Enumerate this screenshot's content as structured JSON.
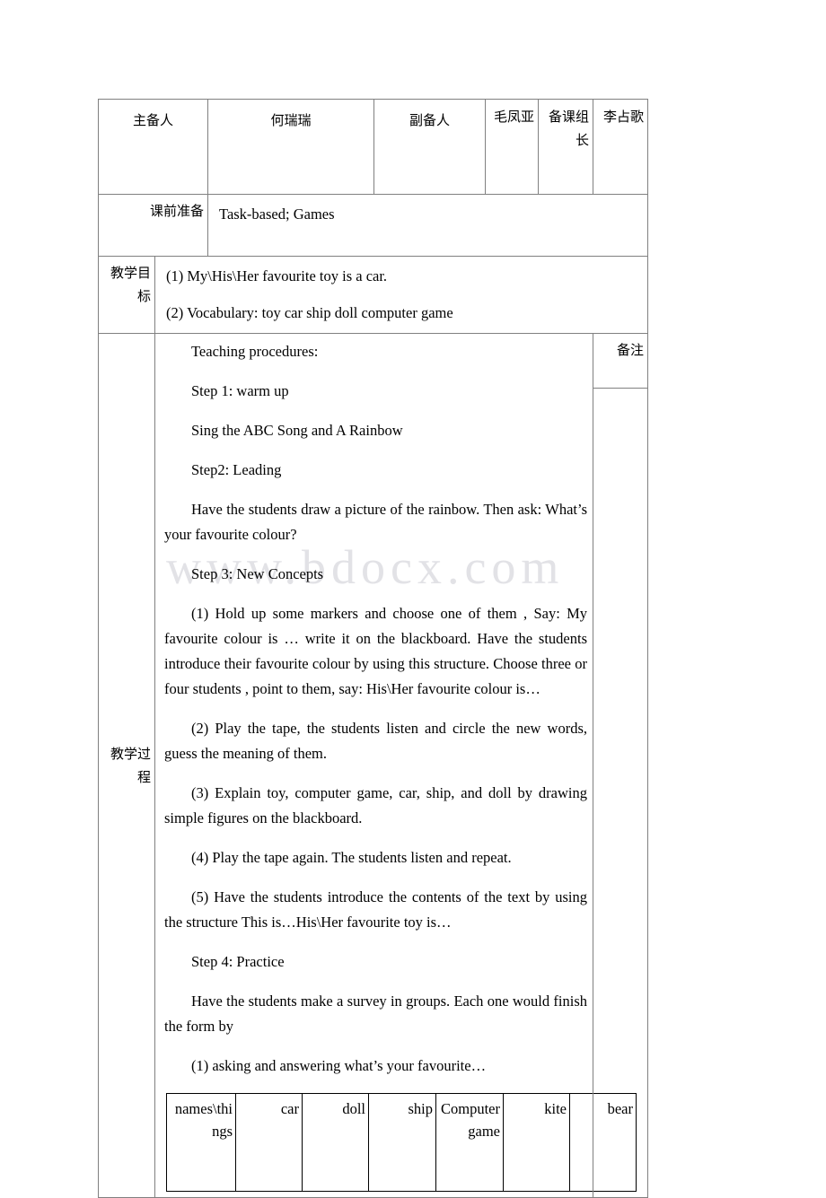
{
  "watermark": {
    "text": "www.bdocx.com"
  },
  "header_row": {
    "main_preparer_label": "主备人",
    "main_preparer_name": "何瑞瑞",
    "assistant_preparer_label": "副备人",
    "assistant_preparer_name": "毛凤亚",
    "group_leader_label": "备课组长",
    "group_leader_name": "李占歌"
  },
  "prep_row": {
    "label": "课前准备",
    "value": "Task-based; Games"
  },
  "objectives_row": {
    "label": "教学目标",
    "items": [
      "(1) My\\His\\Her favourite toy is a car.",
      "(2) Vocabulary: toy car ship doll computer game"
    ]
  },
  "process_row": {
    "label": "教学过程",
    "notes_label": "备注",
    "paragraphs": [
      "Teaching procedures:",
      "Step 1: warm up",
      "Sing the ABC Song and A Rainbow",
      "Step2: Leading",
      "Have the students draw a picture of the rainbow. Then ask: What’s your favourite colour?",
      "Step 3: New Concepts",
      "(1) Hold up some markers and choose one of them , Say: My favourite colour is … write it on the blackboard. Have the students introduce their favourite colour by using this structure. Choose three or four students , point to them, say: His\\Her favourite colour is…",
      "(2) Play the tape, the students listen and circle the new words, guess the meaning of them.",
      "(3) Explain toy, computer game, car, ship, and doll by drawing simple figures on the blackboard.",
      "(4) Play the tape again. The students listen and repeat.",
      "(5) Have the students introduce the contents of the text by using the structure This is…His\\Her favourite toy is…",
      "Step 4: Practice",
      "Have the students make a survey in groups. Each one would finish the form by",
      "(1) asking and answering what’s your favourite…"
    ]
  },
  "survey_table": {
    "headers": [
      "names\\things",
      "car",
      "doll",
      "ship",
      "Computer game",
      "kite",
      "bear"
    ]
  }
}
